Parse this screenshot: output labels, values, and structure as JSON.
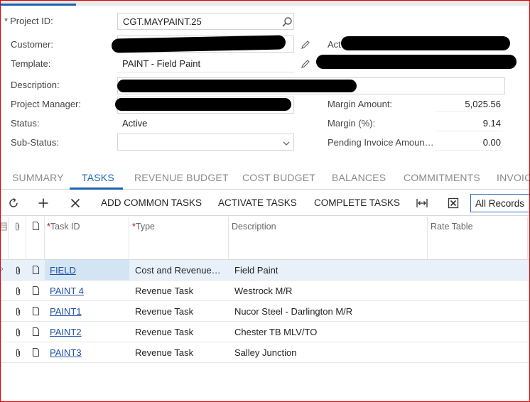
{
  "form": {
    "project_id_label": "Project ID:",
    "project_id_value": "CGT.MAYPAINT.25",
    "customer_label": "Customer:",
    "template_label": "Template:",
    "template_value": "PAINT - Field Paint",
    "description_label": "Description:",
    "project_manager_label": "Project Manager:",
    "status_label": "Status:",
    "status_value": "Active",
    "substatus_label": "Sub-Status:",
    "substatus_value": "",
    "right_partial_label": "Act",
    "margin_amount_label": "Margin Amount:",
    "margin_amount_value": "5,025.56",
    "margin_pct_label": "Margin (%):",
    "margin_pct_value": "9.14",
    "pending_invoice_label": "Pending Invoice Amoun…",
    "pending_invoice_value": "0.00"
  },
  "tabs": [
    {
      "label": "SUMMARY"
    },
    {
      "label": "TASKS"
    },
    {
      "label": "REVENUE BUDGET"
    },
    {
      "label": "COST BUDGET"
    },
    {
      "label": "BALANCES"
    },
    {
      "label": "COMMITMENTS"
    },
    {
      "label": "INVOIC"
    }
  ],
  "active_tab": "TASKS",
  "toolbar": {
    "add_common_tasks": "ADD COMMON TASKS",
    "activate_tasks": "ACTIVATE TASKS",
    "complete_tasks": "COMPLETE TASKS",
    "filter_value": "All Records"
  },
  "grid": {
    "columns": [
      "Task ID",
      "Type",
      "Description",
      "Rate Table"
    ],
    "rows": [
      {
        "task_id": "FIELD",
        "type": "Cost and Revenue…",
        "description": "Field Paint",
        "rate_table": ""
      },
      {
        "task_id": "PAINT 4",
        "type": "Revenue Task",
        "description": "Westrock M/R",
        "rate_table": ""
      },
      {
        "task_id": "PAINT1",
        "type": "Revenue Task",
        "description": "Nucor Steel - Darlington M/R",
        "rate_table": ""
      },
      {
        "task_id": "PAINT2",
        "type": "Revenue Task",
        "description": "Chester TB MLV/TO",
        "rate_table": ""
      },
      {
        "task_id": "PAINT3",
        "type": "Revenue Task",
        "description": "Salley Junction",
        "rate_table": ""
      }
    ]
  },
  "colors": {
    "accent": "#1d63b3",
    "link": "#1d4ea8",
    "selected_row": "#e8f1fa",
    "frame": "#e00000"
  },
  "icons": [
    "search-icon",
    "edit-pencil-icon",
    "chevron-down-icon",
    "refresh-icon",
    "plus-icon",
    "close-icon",
    "fit-columns-icon",
    "excel-export-icon",
    "paperclip-icon",
    "document-icon"
  ]
}
